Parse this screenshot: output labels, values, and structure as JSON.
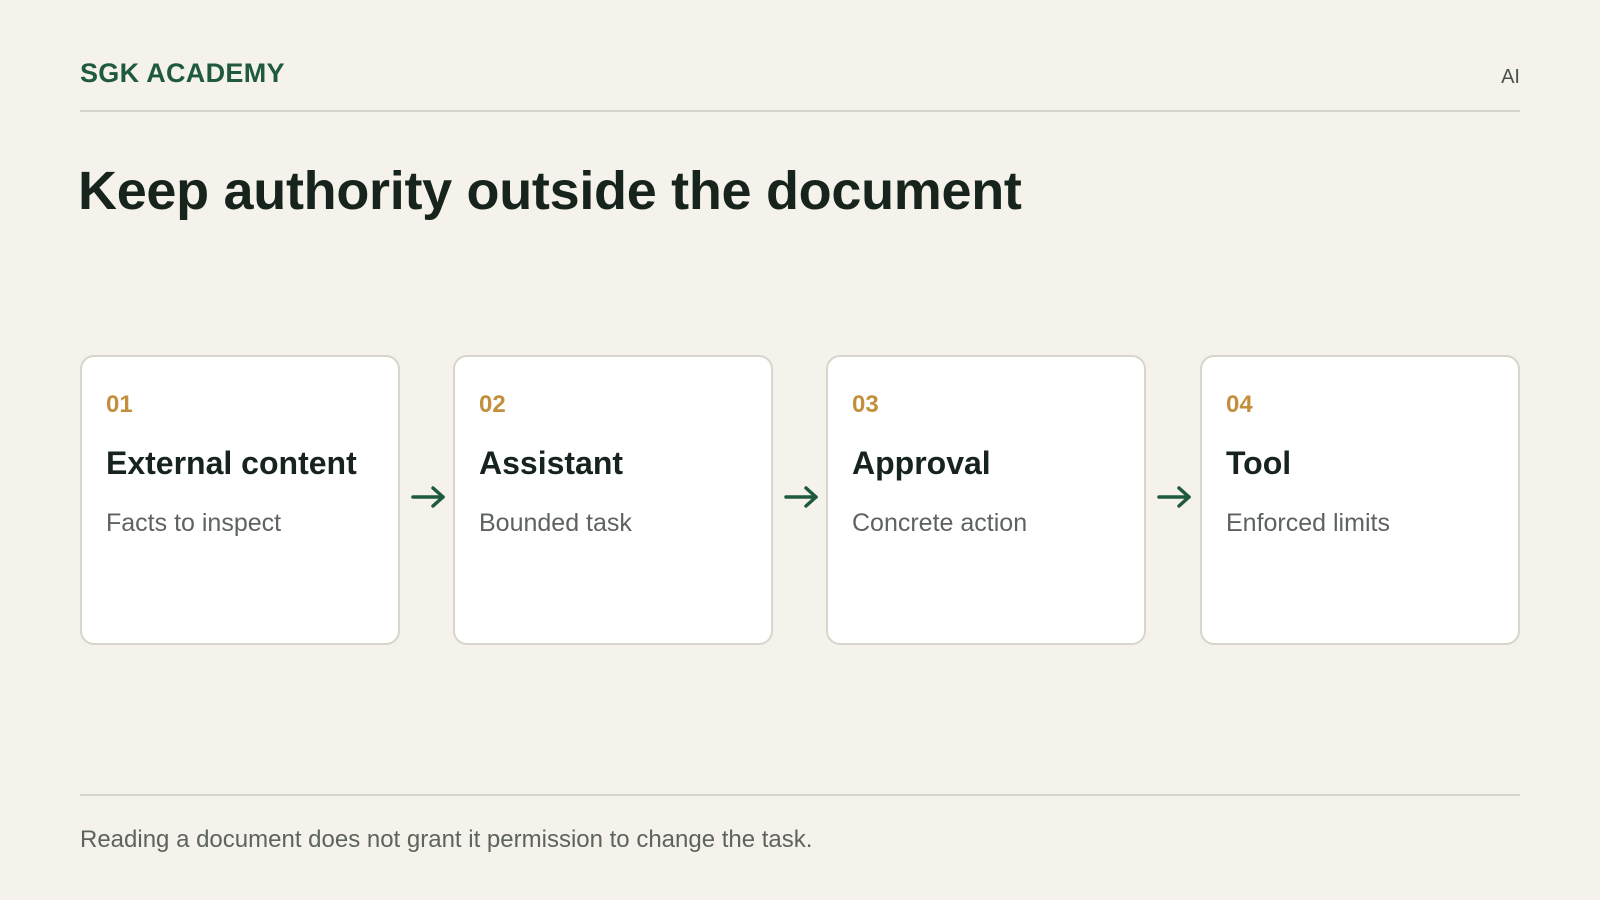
{
  "header": {
    "brand": "SGK ACADEMY",
    "corner_label": "AI"
  },
  "title": "Keep authority outside the document",
  "steps": [
    {
      "number": "01",
      "name": "External content",
      "description": "Facts to inspect"
    },
    {
      "number": "02",
      "name": "Assistant",
      "description": "Bounded task"
    },
    {
      "number": "03",
      "name": "Approval",
      "description": "Concrete action"
    },
    {
      "number": "04",
      "name": "Tool",
      "description": "Enforced limits"
    }
  ],
  "arrow_icon": "arrow-right-icon",
  "footer": {
    "note": "Reading a document does not grant it permission to change the task."
  },
  "colors": {
    "background": "#f5f2eb",
    "brand": "#1f5a3e",
    "step_number": "#c38f3c",
    "arrow": "#1f5a3e",
    "card": "#ffffff"
  }
}
